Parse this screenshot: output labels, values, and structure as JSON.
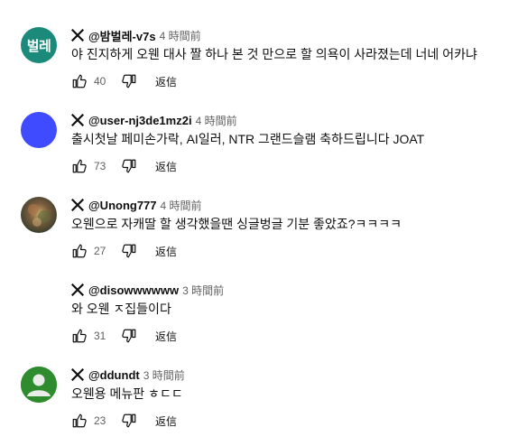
{
  "comments": [
    {
      "avatar_text": "벌레",
      "avatar_color": "#1b8a7a",
      "author": "@밤벌레-v7s",
      "time": "4 時間前",
      "text": "야 진지하게 오웬 대사 짤 하나 본 것 만으로 할 의욕이 사라졌는데 너네 어카냐",
      "likes": "40",
      "reply_label": "返信"
    },
    {
      "avatar_text": "",
      "avatar_color": "#3f4bff",
      "author": "@user-nj3de1mz2i",
      "time": "4 時間前",
      "text": "출시첫날 페미손가락, AI일러, NTR 그랜드슬램 축하드립니다 JOAT",
      "likes": "73",
      "reply_label": "返信"
    },
    {
      "avatar_text": "",
      "avatar_color": "#6b5a48",
      "author": "@Unong777",
      "time": "4 時間前",
      "text": "오웬으로 자캐딸 할 생각했을땐 싱글벙글 기분 좋았죠?ㅋㅋㅋㅋ",
      "likes": "27",
      "reply_label": "返信"
    },
    {
      "avatar_text": "",
      "avatar_color": "",
      "author": "@disowwwwww",
      "time": "3 時間前",
      "text": "와 오웬 ㅈ집들이다",
      "likes": "31",
      "reply_label": "返信"
    },
    {
      "avatar_text": "",
      "avatar_color": "#2e8b2e",
      "author": "@ddundt",
      "time": "3 時間前",
      "text": "오웬용 메뉴판 ㅎㄷㄷ",
      "likes": "23",
      "reply_label": "返信"
    }
  ]
}
